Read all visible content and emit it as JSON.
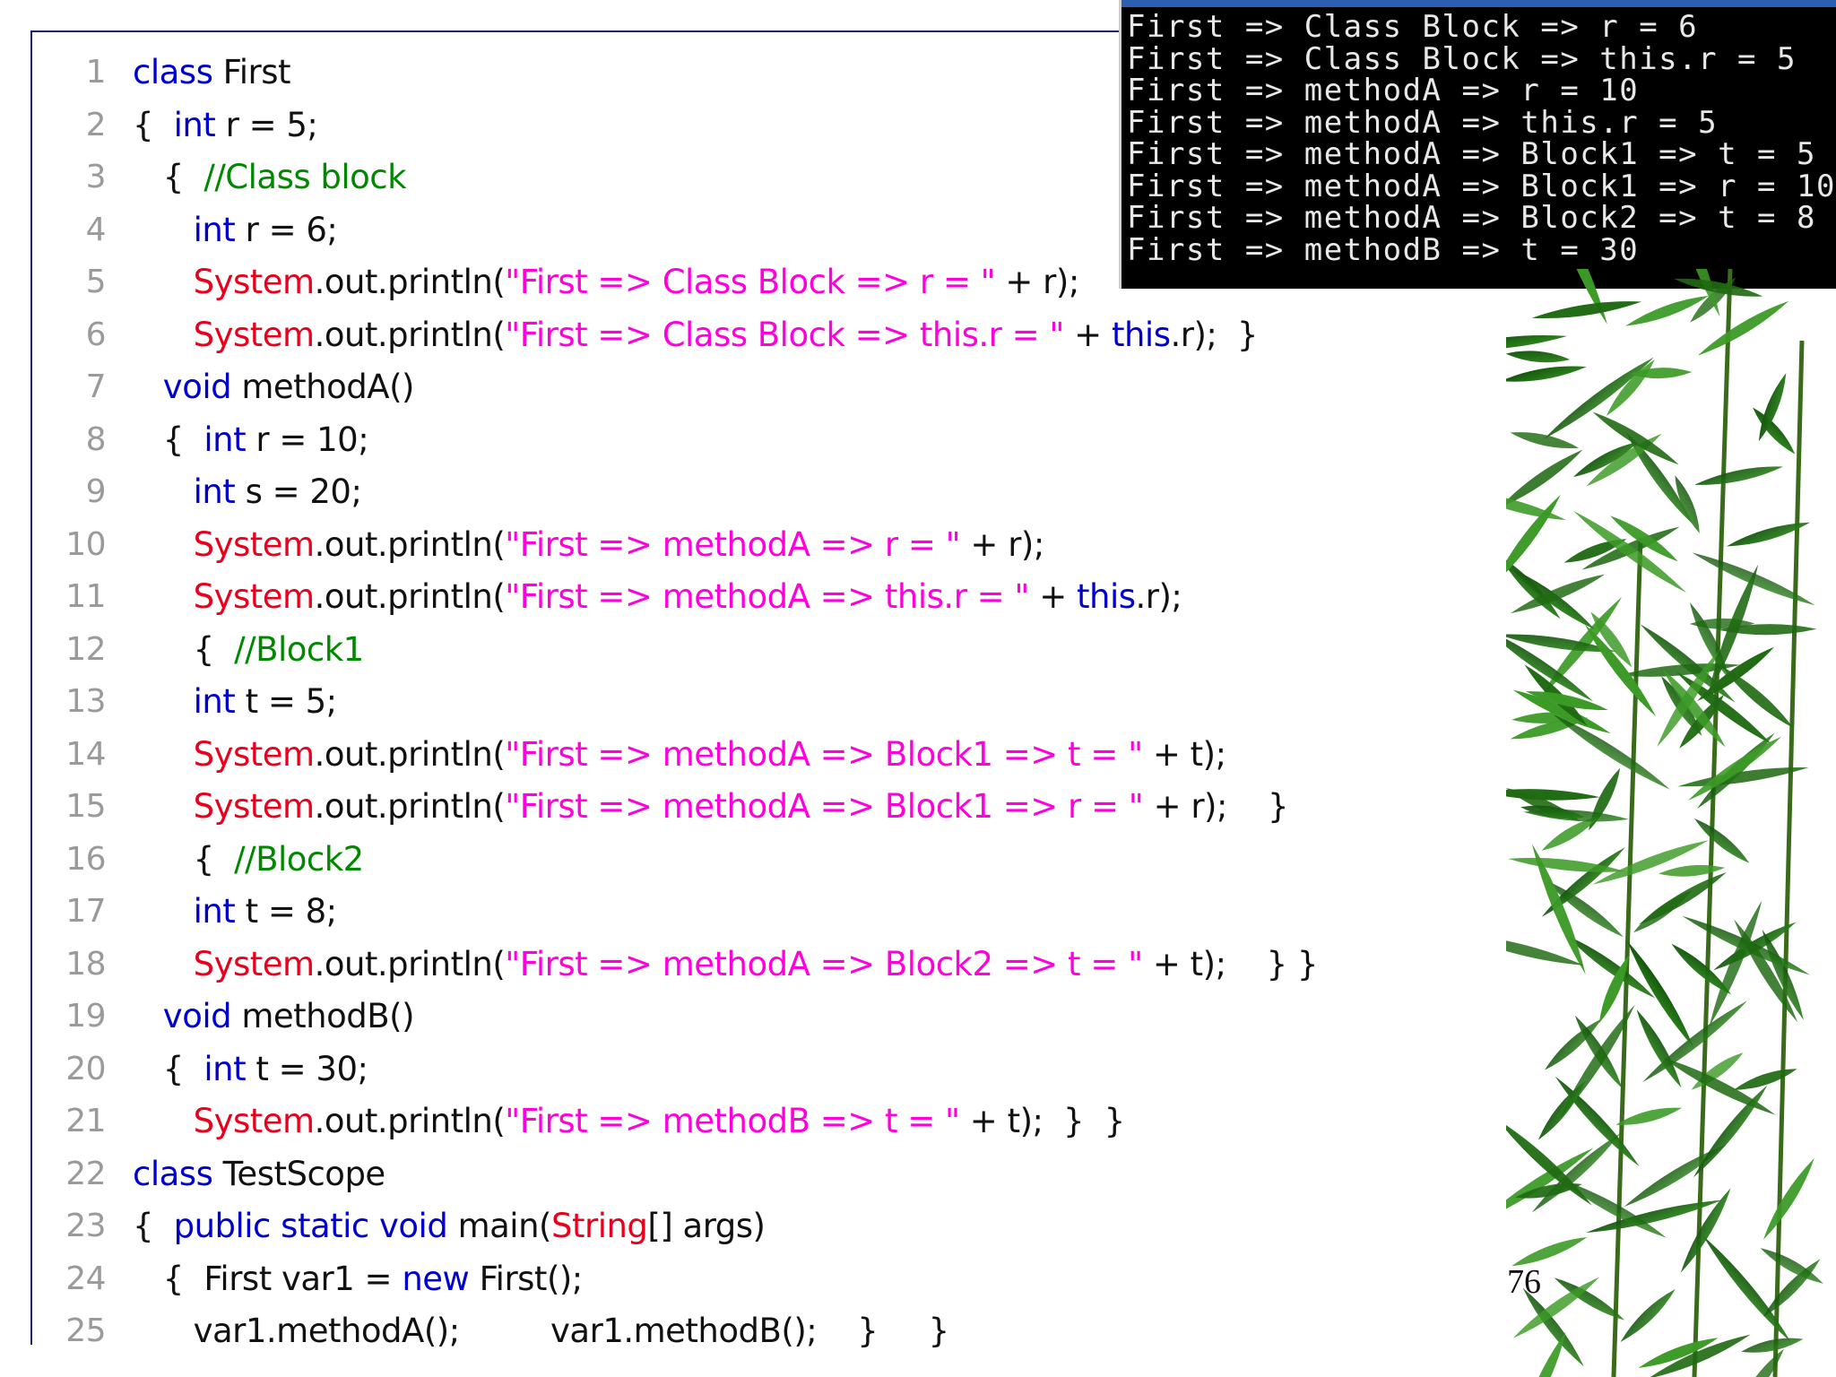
{
  "code": {
    "lines": [
      {
        "n": "1",
        "parts": [
          {
            "t": "class",
            "c": "k"
          },
          {
            "t": " First",
            "c": "p"
          }
        ]
      },
      {
        "n": "2",
        "parts": [
          {
            "t": "{  ",
            "c": "p"
          },
          {
            "t": "int",
            "c": "k"
          },
          {
            "t": " r = 5;",
            "c": "p"
          }
        ]
      },
      {
        "n": "3",
        "parts": [
          {
            "t": "   {  ",
            "c": "p"
          },
          {
            "t": "//Class block",
            "c": "c"
          }
        ]
      },
      {
        "n": "4",
        "parts": [
          {
            "t": "      ",
            "c": "p"
          },
          {
            "t": "int",
            "c": "k"
          },
          {
            "t": " r = 6;",
            "c": "p"
          }
        ]
      },
      {
        "n": "5",
        "parts": [
          {
            "t": "      ",
            "c": "p"
          },
          {
            "t": "System",
            "c": "r"
          },
          {
            "t": ".out.println(",
            "c": "p"
          },
          {
            "t": "\"First => Class Block => r = \"",
            "c": "s"
          },
          {
            "t": " + r);",
            "c": "p"
          }
        ]
      },
      {
        "n": "6",
        "parts": [
          {
            "t": "      ",
            "c": "p"
          },
          {
            "t": "System",
            "c": "r"
          },
          {
            "t": ".out.println(",
            "c": "p"
          },
          {
            "t": "\"First => Class Block => this.r = \"",
            "c": "s"
          },
          {
            "t": " + ",
            "c": "p"
          },
          {
            "t": "this",
            "c": "k"
          },
          {
            "t": ".r);  }",
            "c": "p"
          }
        ]
      },
      {
        "n": "7",
        "parts": [
          {
            "t": "   ",
            "c": "p"
          },
          {
            "t": "void",
            "c": "k"
          },
          {
            "t": " methodA()",
            "c": "p"
          }
        ]
      },
      {
        "n": "8",
        "parts": [
          {
            "t": "   {  ",
            "c": "p"
          },
          {
            "t": "int",
            "c": "k"
          },
          {
            "t": " r = 10;",
            "c": "p"
          }
        ]
      },
      {
        "n": "9",
        "parts": [
          {
            "t": "      ",
            "c": "p"
          },
          {
            "t": "int",
            "c": "k"
          },
          {
            "t": " s = 20;",
            "c": "p"
          }
        ]
      },
      {
        "n": "10",
        "parts": [
          {
            "t": "      ",
            "c": "p"
          },
          {
            "t": "System",
            "c": "r"
          },
          {
            "t": ".out.println(",
            "c": "p"
          },
          {
            "t": "\"First => methodA => r = \"",
            "c": "s"
          },
          {
            "t": " + r);",
            "c": "p"
          }
        ]
      },
      {
        "n": "11",
        "parts": [
          {
            "t": "      ",
            "c": "p"
          },
          {
            "t": "System",
            "c": "r"
          },
          {
            "t": ".out.println(",
            "c": "p"
          },
          {
            "t": "\"First => methodA => this.r = \"",
            "c": "s"
          },
          {
            "t": " + ",
            "c": "p"
          },
          {
            "t": "this",
            "c": "k"
          },
          {
            "t": ".r);",
            "c": "p"
          }
        ]
      },
      {
        "n": "12",
        "parts": [
          {
            "t": "      {  ",
            "c": "p"
          },
          {
            "t": "//Block1",
            "c": "c"
          }
        ]
      },
      {
        "n": "13",
        "parts": [
          {
            "t": "      ",
            "c": "p"
          },
          {
            "t": "int",
            "c": "k"
          },
          {
            "t": " t = 5;",
            "c": "p"
          }
        ]
      },
      {
        "n": "14",
        "parts": [
          {
            "t": "      ",
            "c": "p"
          },
          {
            "t": "System",
            "c": "r"
          },
          {
            "t": ".out.println(",
            "c": "p"
          },
          {
            "t": "\"First => methodA => Block1 => t = \"",
            "c": "s"
          },
          {
            "t": " + t);",
            "c": "p"
          }
        ]
      },
      {
        "n": "15",
        "parts": [
          {
            "t": "      ",
            "c": "p"
          },
          {
            "t": "System",
            "c": "r"
          },
          {
            "t": ".out.println(",
            "c": "p"
          },
          {
            "t": "\"First => methodA => Block1 => r = \"",
            "c": "s"
          },
          {
            "t": " + r);    }",
            "c": "p"
          }
        ]
      },
      {
        "n": "16",
        "parts": [
          {
            "t": "      {  ",
            "c": "p"
          },
          {
            "t": "//Block2",
            "c": "c"
          }
        ]
      },
      {
        "n": "17",
        "parts": [
          {
            "t": "      ",
            "c": "p"
          },
          {
            "t": "int",
            "c": "k"
          },
          {
            "t": " t = 8;",
            "c": "p"
          }
        ]
      },
      {
        "n": "18",
        "parts": [
          {
            "t": "      ",
            "c": "p"
          },
          {
            "t": "System",
            "c": "r"
          },
          {
            "t": ".out.println(",
            "c": "p"
          },
          {
            "t": "\"First => methodA => Block2 => t = \"",
            "c": "s"
          },
          {
            "t": " + t);    } }",
            "c": "p"
          }
        ]
      },
      {
        "n": "19",
        "parts": [
          {
            "t": "   ",
            "c": "p"
          },
          {
            "t": "void",
            "c": "k"
          },
          {
            "t": " methodB()",
            "c": "p"
          }
        ]
      },
      {
        "n": "20",
        "parts": [
          {
            "t": "   {  ",
            "c": "p"
          },
          {
            "t": "int",
            "c": "k"
          },
          {
            "t": " t = 30;",
            "c": "p"
          }
        ]
      },
      {
        "n": "21",
        "parts": [
          {
            "t": "      ",
            "c": "p"
          },
          {
            "t": "System",
            "c": "r"
          },
          {
            "t": ".out.println(",
            "c": "p"
          },
          {
            "t": "\"First => methodB => t = \"",
            "c": "s"
          },
          {
            "t": " + t);  }  }",
            "c": "p"
          }
        ]
      },
      {
        "n": "22",
        "parts": [
          {
            "t": "class",
            "c": "k"
          },
          {
            "t": " TestScope",
            "c": "p"
          }
        ]
      },
      {
        "n": "23",
        "parts": [
          {
            "t": "{  ",
            "c": "p"
          },
          {
            "t": "public static void",
            "c": "k"
          },
          {
            "t": " main(",
            "c": "p"
          },
          {
            "t": "String",
            "c": "r"
          },
          {
            "t": "[] args)",
            "c": "p"
          }
        ]
      },
      {
        "n": "24",
        "parts": [
          {
            "t": "   {  First var1 = ",
            "c": "p"
          },
          {
            "t": "new",
            "c": "k"
          },
          {
            "t": " First();",
            "c": "p"
          }
        ]
      },
      {
        "n": "25",
        "parts": [
          {
            "t": "      var1.methodA();         var1.methodB();    }     }",
            "c": "p"
          }
        ]
      }
    ]
  },
  "console": {
    "lines": [
      "First => Class Block => r = 6",
      "First => Class Block => this.r = 5",
      "First => methodA => r = 10",
      "First => methodA => this.r = 5",
      "First => methodA => Block1 => t = 5",
      "First => methodA => Block1 => r = 10",
      "First => methodA => Block2 => t = 8",
      "First => methodB => t = 30"
    ]
  },
  "footer": {
    "page_number": "76"
  },
  "colors": {
    "keyword": "#0000cc",
    "string": "#ff00dd",
    "comment": "#008800",
    "class_ref": "#e8001c",
    "line_number": "#9a9a9a",
    "console_bg": "#000000",
    "console_text": "#e8e8e8"
  }
}
